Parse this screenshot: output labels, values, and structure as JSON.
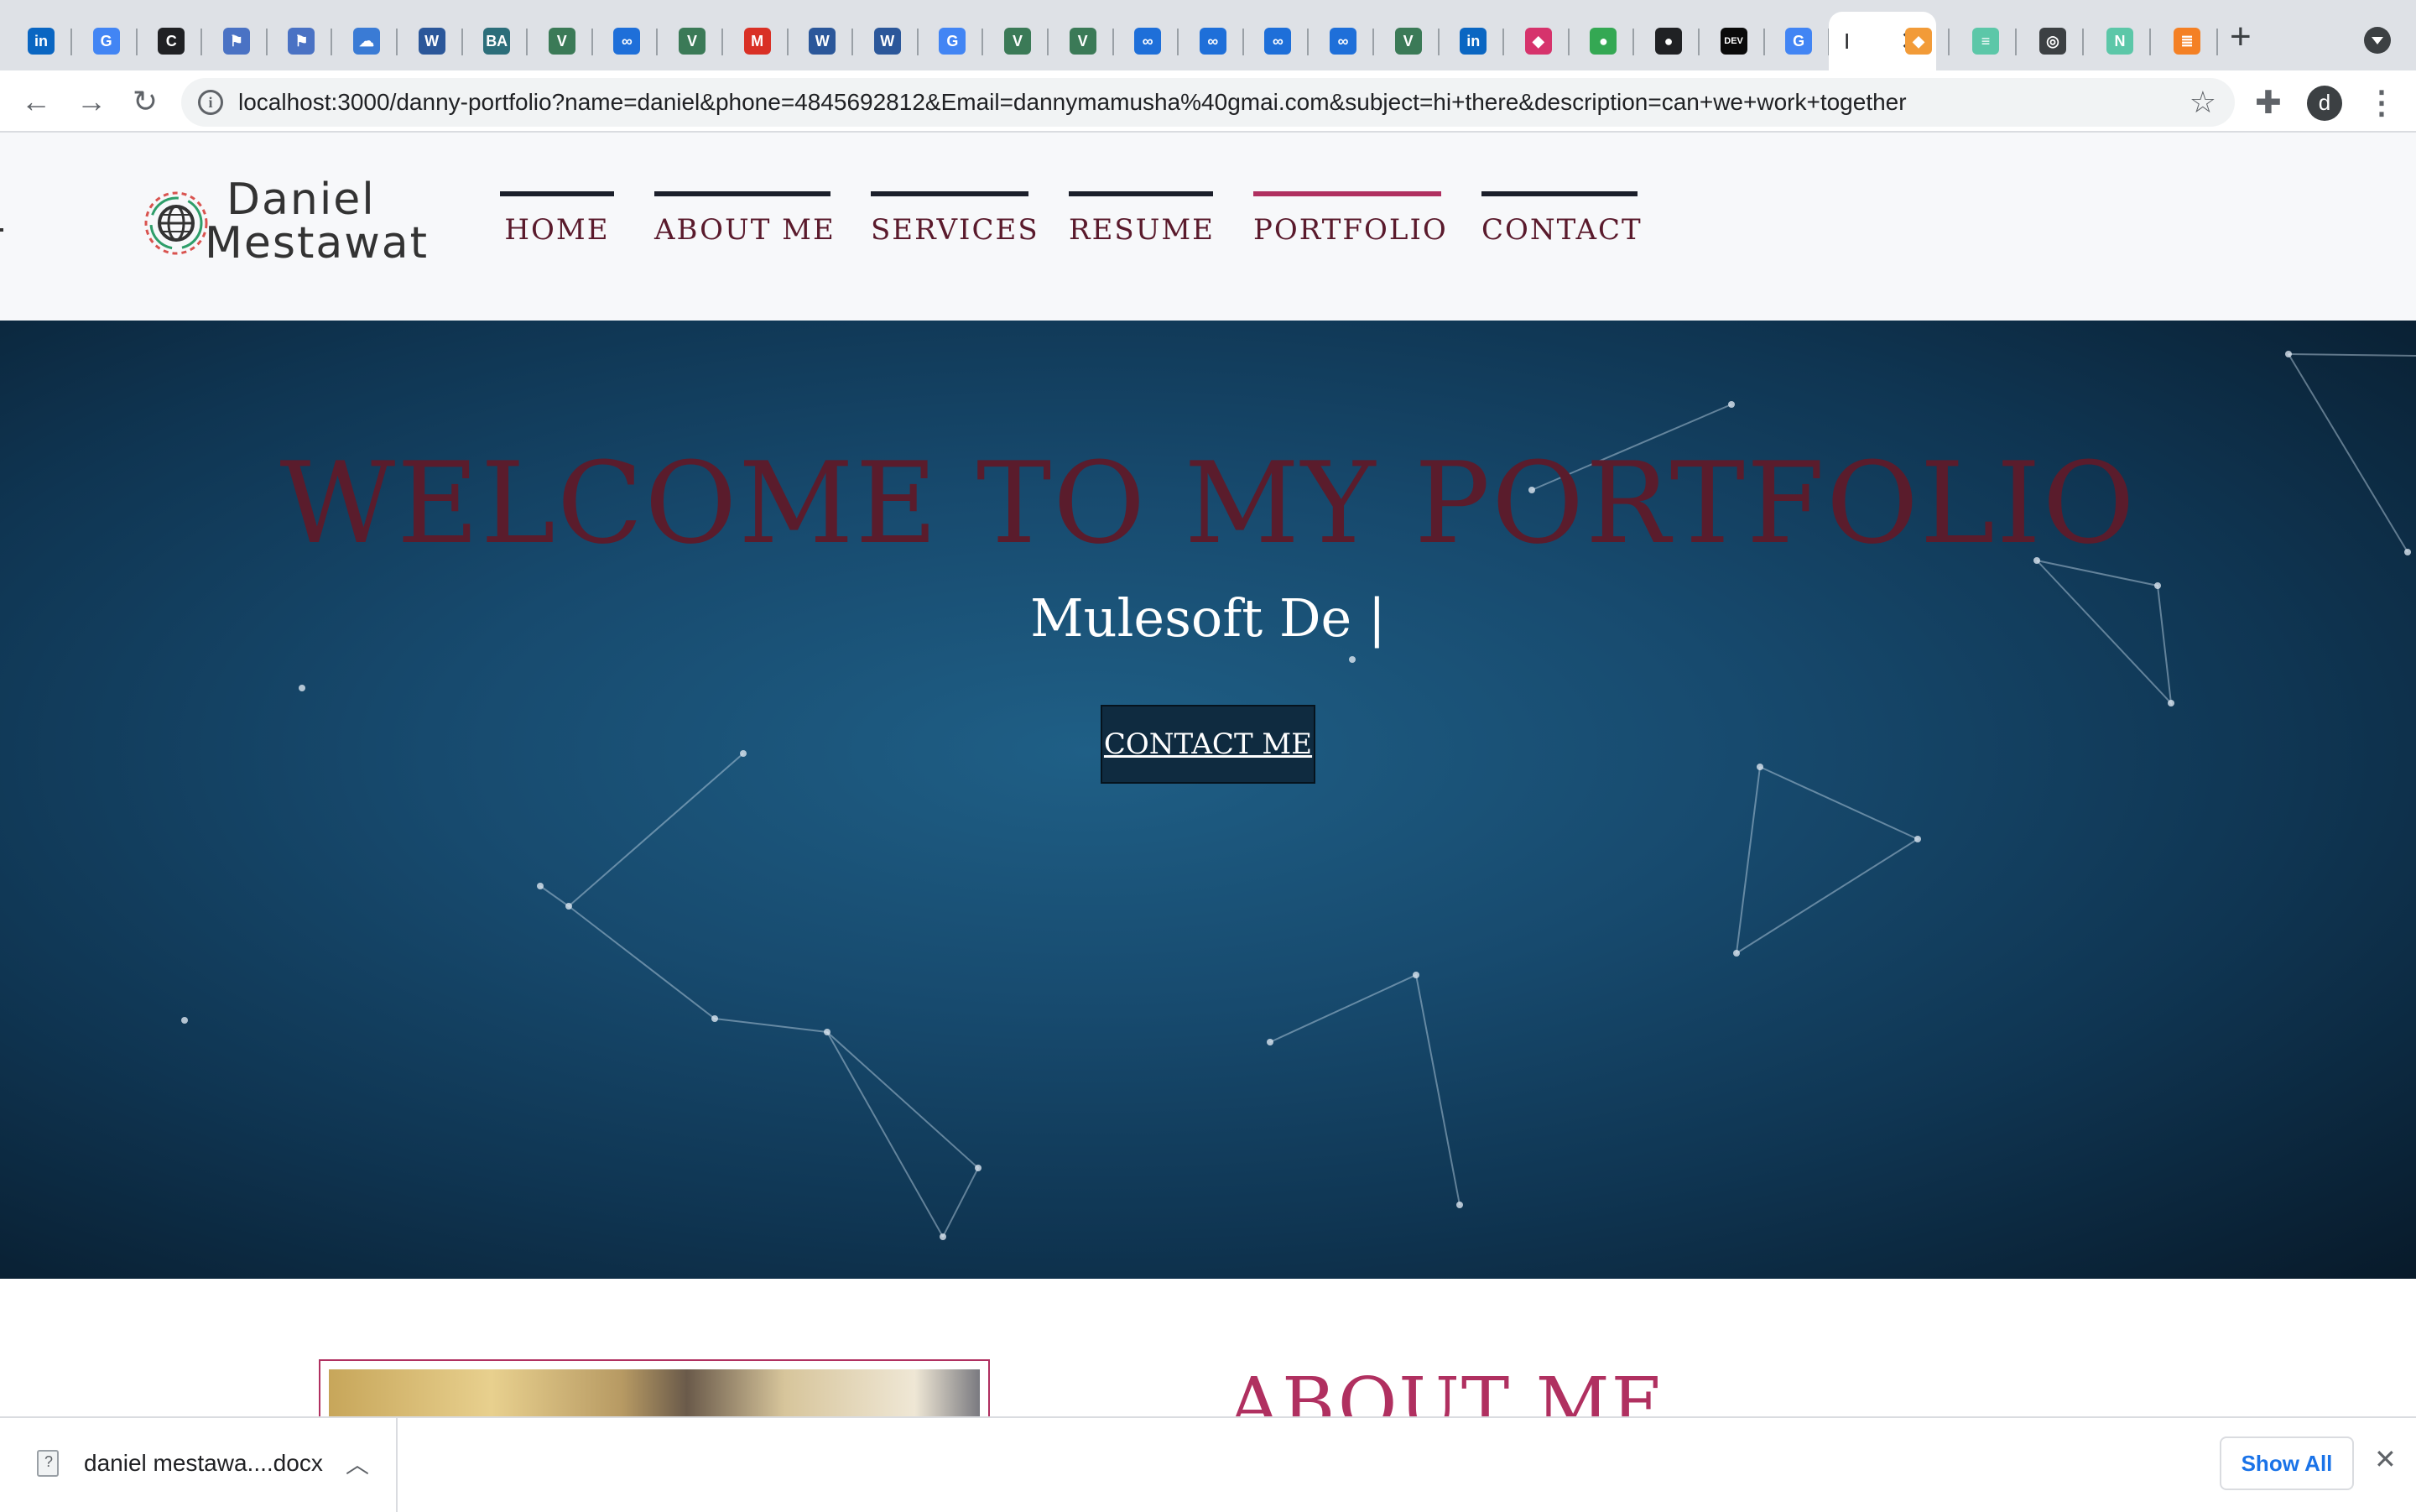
{
  "browser": {
    "tabs": [
      {
        "icon": "linkedin-icon",
        "glyph": "in",
        "color": "#0a66c2"
      },
      {
        "icon": "google-icon",
        "glyph": "G",
        "color": "#4285f4"
      },
      {
        "icon": "c-icon",
        "glyph": "C",
        "color": "#202124"
      },
      {
        "icon": "flag-icon",
        "glyph": "⚑",
        "color": "#4a72c4"
      },
      {
        "icon": "flag-icon",
        "glyph": "⚑",
        "color": "#4a72c4"
      },
      {
        "icon": "cloud-icon",
        "glyph": "☁",
        "color": "#3a7bd5"
      },
      {
        "icon": "w-icon",
        "glyph": "W",
        "color": "#2b579a"
      },
      {
        "icon": "booz-allen-icon",
        "glyph": "BA",
        "color": "#2c6e7a"
      },
      {
        "icon": "vec-icon",
        "glyph": "V",
        "color": "#3b7a57"
      },
      {
        "icon": "go-icon",
        "glyph": "∞",
        "color": "#1e6fd9"
      },
      {
        "icon": "vec-icon",
        "glyph": "V",
        "color": "#3b7a57"
      },
      {
        "icon": "gmail-icon",
        "glyph": "M",
        "color": "#d93025"
      },
      {
        "icon": "w-icon",
        "glyph": "W",
        "color": "#2b579a"
      },
      {
        "icon": "w-icon",
        "glyph": "W",
        "color": "#2b579a"
      },
      {
        "icon": "google-icon",
        "glyph": "G",
        "color": "#4285f4"
      },
      {
        "icon": "vec-icon",
        "glyph": "V",
        "color": "#3b7a57"
      },
      {
        "icon": "vec-icon",
        "glyph": "V",
        "color": "#3b7a57"
      },
      {
        "icon": "go-icon",
        "glyph": "∞",
        "color": "#1e6fd9"
      },
      {
        "icon": "go-icon",
        "glyph": "∞",
        "color": "#1e6fd9"
      },
      {
        "icon": "go-icon",
        "glyph": "∞",
        "color": "#1e6fd9"
      },
      {
        "icon": "go-icon",
        "glyph": "∞",
        "color": "#1e6fd9"
      },
      {
        "icon": "vec-icon",
        "glyph": "V",
        "color": "#3b7a57"
      },
      {
        "icon": "linkedin-icon",
        "glyph": "in",
        "color": "#0a66c2"
      },
      {
        "icon": "app-icon",
        "glyph": "◆",
        "color": "#d6336c"
      },
      {
        "icon": "maps-icon",
        "glyph": "●",
        "color": "#34a853"
      },
      {
        "icon": "github-icon",
        "glyph": "●",
        "color": "#202124"
      },
      {
        "icon": "dev-icon",
        "glyph": "DEV",
        "color": "#0a0a0a"
      },
      {
        "icon": "google-icon",
        "glyph": "G",
        "color": "#4285f4"
      }
    ],
    "tabs_after": [
      {
        "icon": "flag-orange-icon",
        "glyph": "◆",
        "color": "#f29b38"
      },
      {
        "icon": "stripes-icon",
        "glyph": "≡",
        "color": "#5cc7a8"
      },
      {
        "icon": "globe-icon",
        "glyph": "◎",
        "color": "#3c4043"
      },
      {
        "icon": "nylas-icon",
        "glyph": "N",
        "color": "#5cc7a8"
      },
      {
        "icon": "stack-icon",
        "glyph": "≣",
        "color": "#f48024"
      }
    ],
    "active_tab_glyph": "I",
    "url": "localhost:3000/danny-portfolio?name=daniel&phone=4845692812&Email=dannymamusha%40gmai.com&subject=hi+there&description=can+we+work+together",
    "avatar_letter": "d"
  },
  "site": {
    "logo": {
      "line1": "Daniel",
      "line2": "Mestawat"
    },
    "nav": [
      {
        "label": "HOME",
        "active": false
      },
      {
        "label": "ABOUT ME",
        "active": false
      },
      {
        "label": "SERVICES",
        "active": false
      },
      {
        "label": "RESUME",
        "active": false
      },
      {
        "label": "PORTFOLIO",
        "active": true
      },
      {
        "label": "CONTACT",
        "active": false
      }
    ],
    "hero": {
      "title": "WELCOME TO MY PORTFOLIO",
      "subtitle": "Mulesoft De |",
      "button": "CONTACT ME"
    },
    "about": {
      "title": "ABOUT ME"
    }
  },
  "shelf": {
    "filename": "daniel mestawa....docx",
    "show_all": "Show All"
  },
  "colors": {
    "accent": "#b03060",
    "nav_text": "#5a1a2c",
    "hero_title": "#5a1c2c"
  }
}
